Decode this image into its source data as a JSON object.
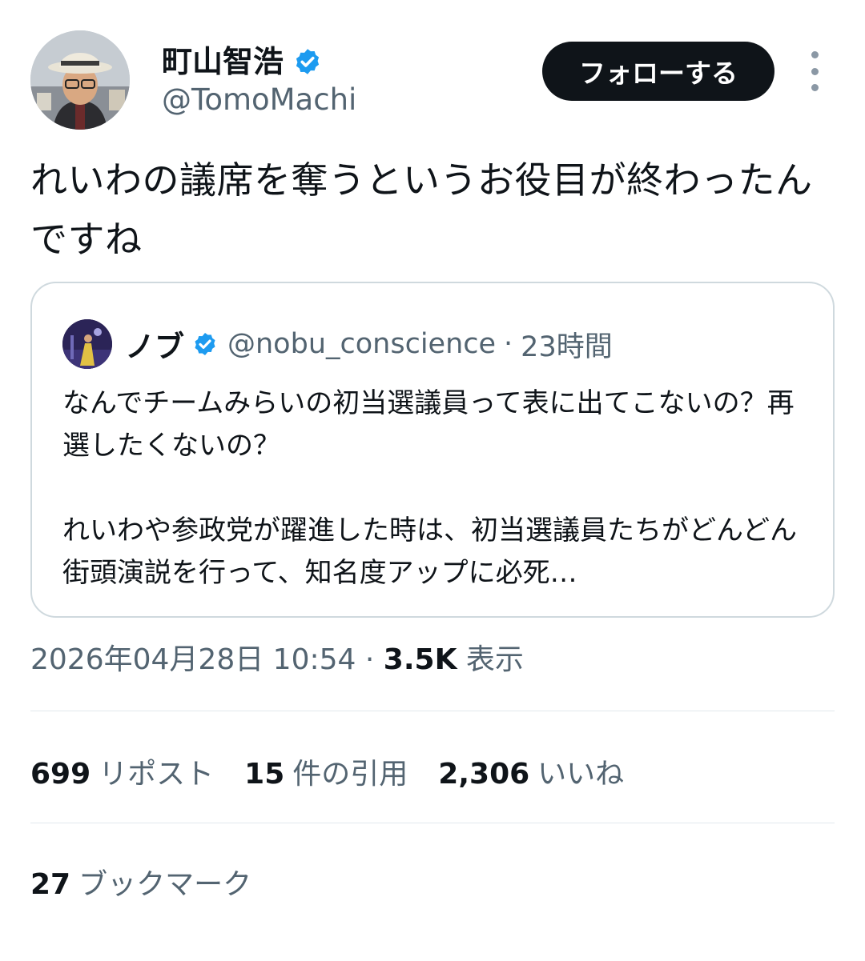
{
  "author": {
    "name": "町山智浩",
    "handle": "@TomoMachi",
    "verified": true,
    "verified_color": "#1d9bf0"
  },
  "actions": {
    "follow_label": "フォローする"
  },
  "tweet": {
    "text": "れいわの議席を奪うというお役目が終わったんですね"
  },
  "quoted": {
    "name": "ノブ",
    "handle": "@nobu_conscience",
    "separator": "·",
    "time": "23時間",
    "text": "なんでチームみらいの初当選議員って表に出てこないの？再選したくないの？\n\nれいわや参政党が躍進した時は、初当選議員たちがどんどん街頭演説を行って、知名度アップに必死…"
  },
  "meta": {
    "timestamp": "2026年04月28日 10:54",
    "separator": "·",
    "views_count": "3.5K",
    "views_label": "表示"
  },
  "stats": {
    "reposts_count": "699",
    "reposts_label": "リポスト",
    "quotes_count": "15",
    "quotes_label": "件の引用",
    "likes_count": "2,306",
    "likes_label": "いいね",
    "bookmarks_count": "27",
    "bookmarks_label": "ブックマーク"
  }
}
